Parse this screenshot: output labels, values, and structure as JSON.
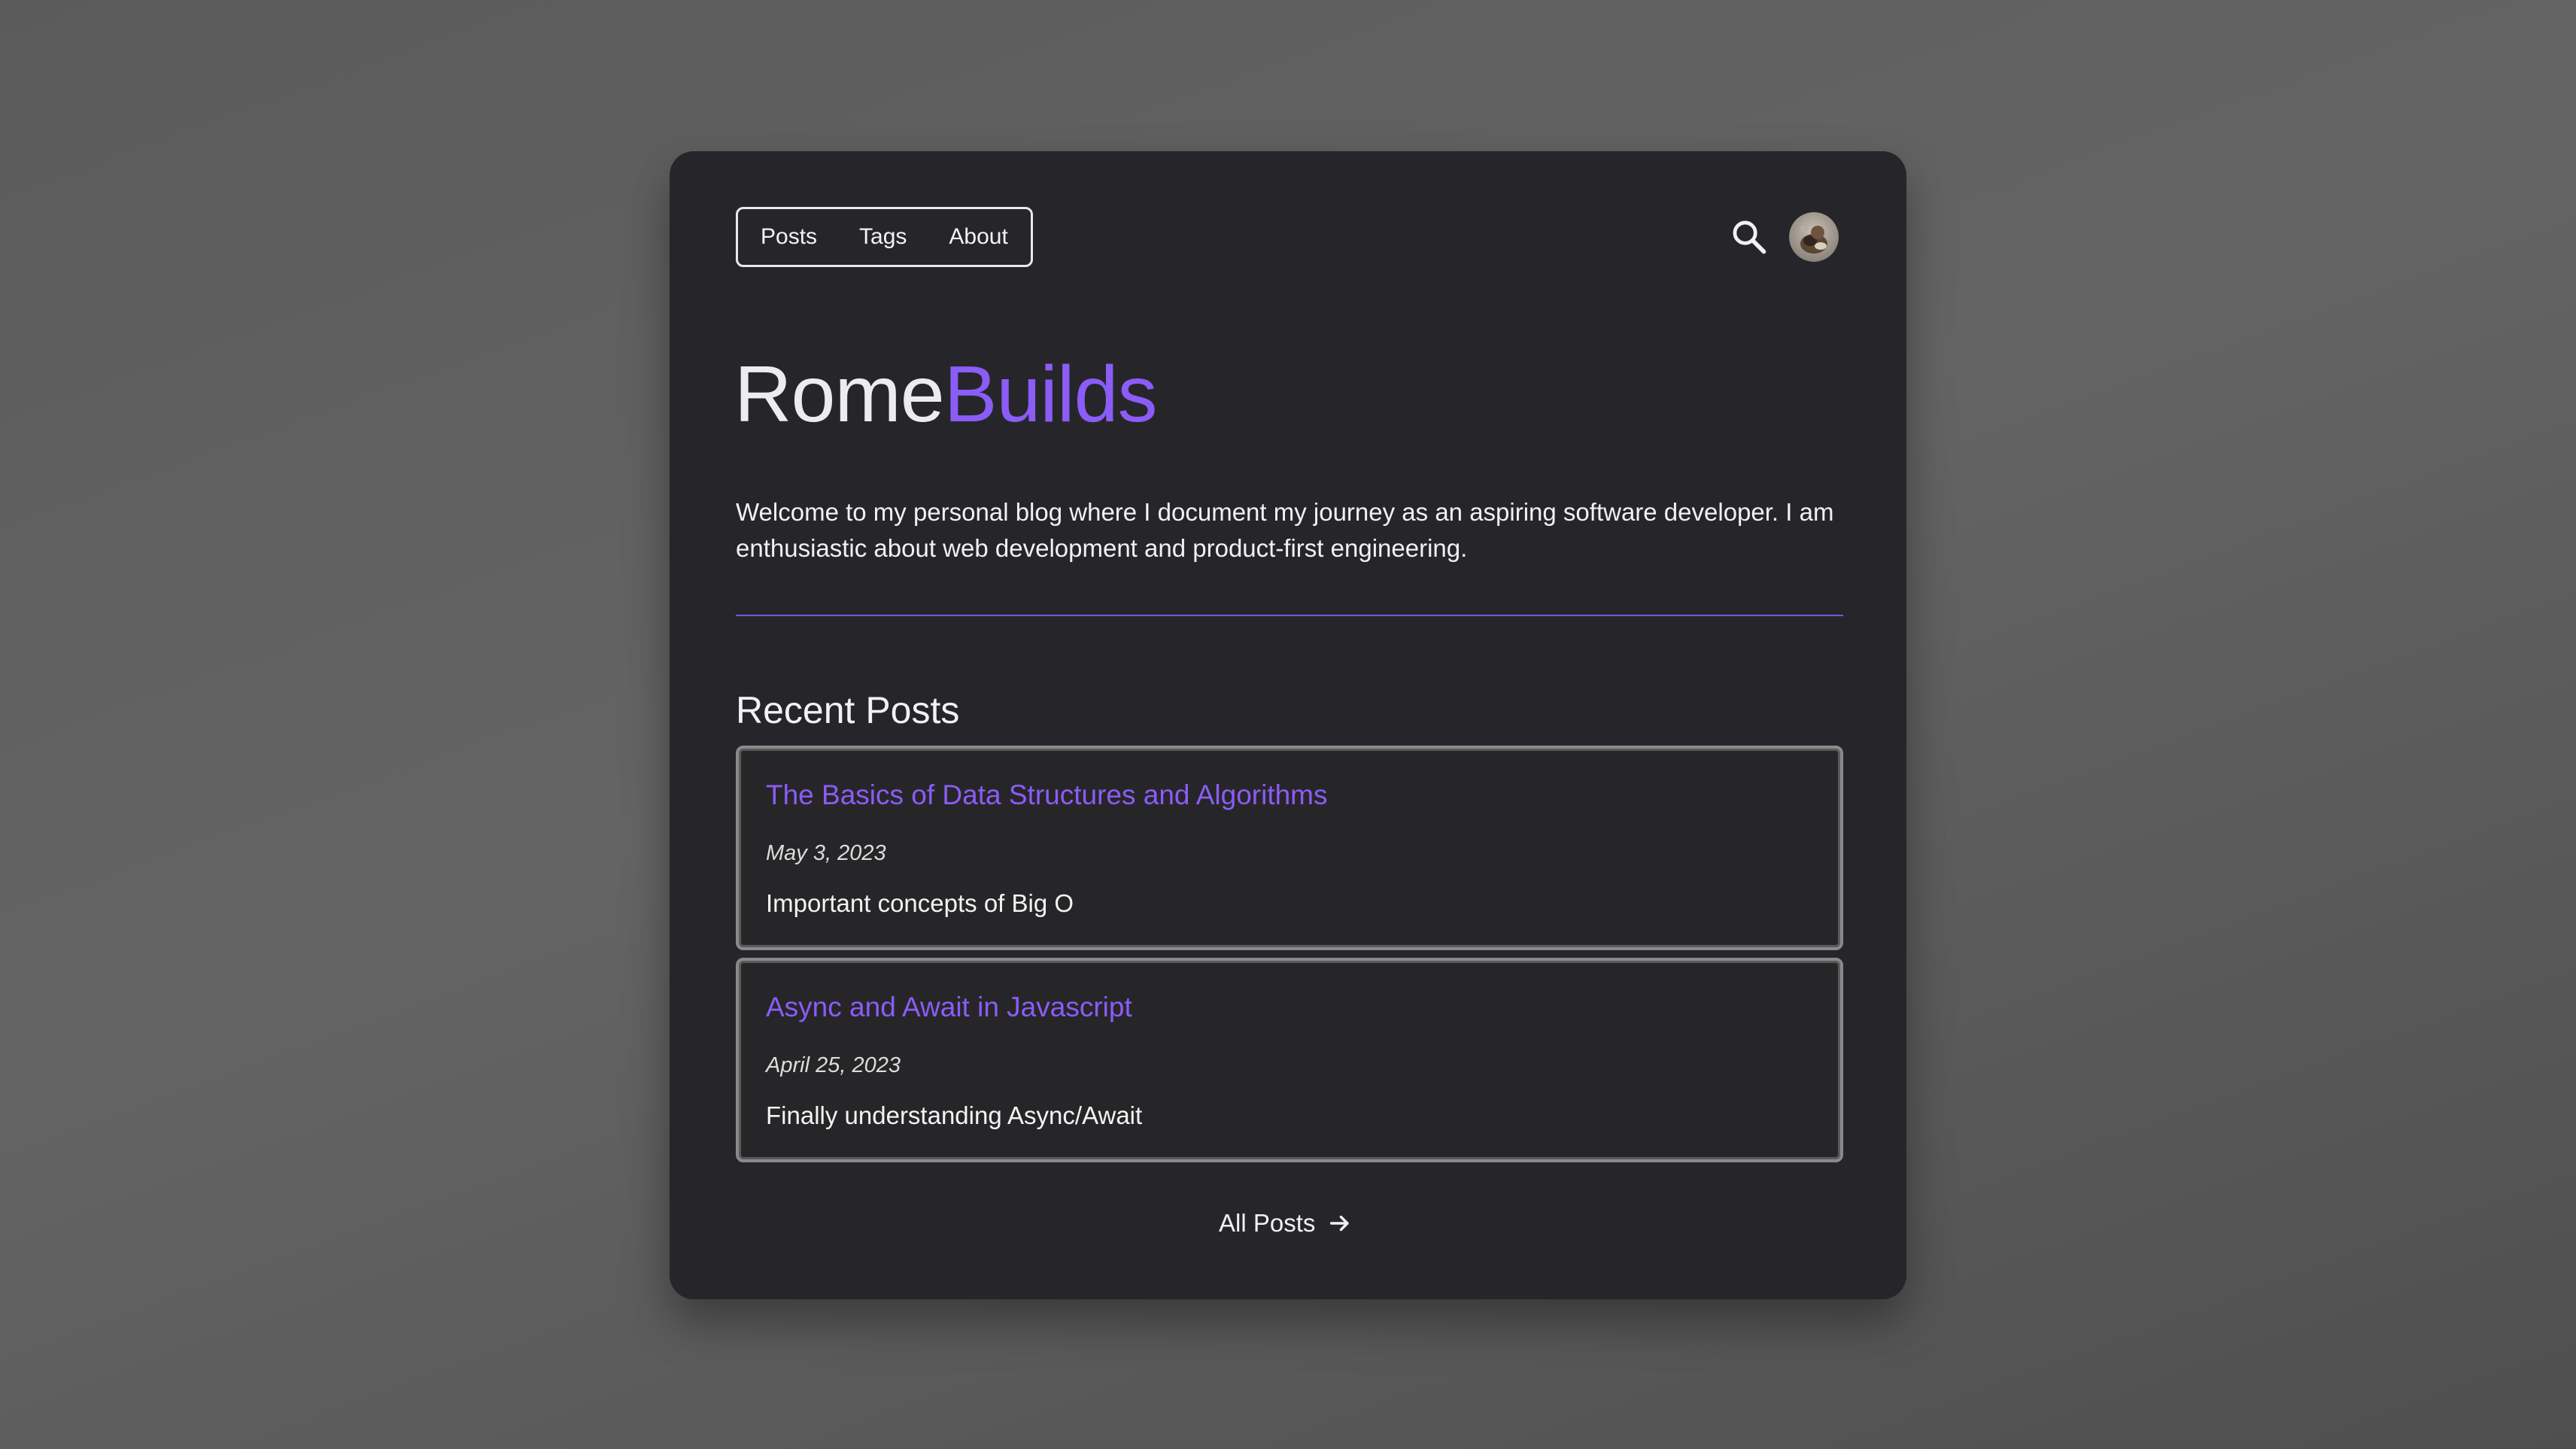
{
  "nav": {
    "items": [
      {
        "label": "Posts"
      },
      {
        "label": "Tags"
      },
      {
        "label": "About"
      }
    ]
  },
  "header_icons": {
    "search": "search-icon",
    "avatar": "user-avatar"
  },
  "hero": {
    "title_first": "Rome",
    "title_second": "Builds",
    "intro": "Welcome to my personal blog where I document my journey as an aspiring software developer. I am enthusiastic about web development and product-first engineering."
  },
  "recent": {
    "heading": "Recent Posts",
    "posts": [
      {
        "title": "The Basics of Data Structures and Algorithms",
        "date": "May 3, 2023",
        "description": "Important concepts of Big O"
      },
      {
        "title": "Async and Await in Javascript",
        "date": "April 25, 2023",
        "description": "Finally understanding Async/Await"
      }
    ],
    "all_posts_label": "All Posts",
    "all_posts_icon": "arrow-right-icon"
  },
  "colors": {
    "accent": "#8b5cf6",
    "card_background": "#26262a",
    "divider": "#6d5bd9",
    "page_background": "#5b5b5b"
  }
}
